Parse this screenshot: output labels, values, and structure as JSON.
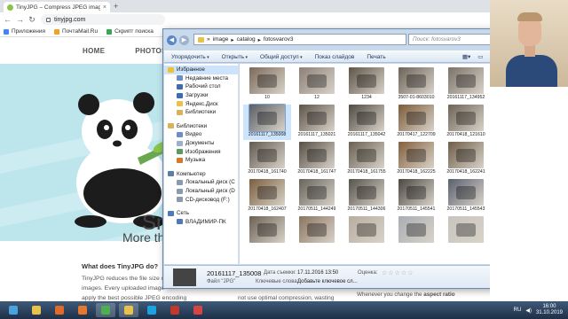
{
  "browser": {
    "tab_title": "TinyJPG – Compress JPEG images",
    "new_tab": "+",
    "url": "tinyjpg.com",
    "bookmarks": [
      "Приложения",
      "ПочтаMail.Ru",
      "Скрипт поиска"
    ]
  },
  "site": {
    "nav": [
      "HOME",
      "PHOTOSHOP"
    ],
    "hero_heading": "Sm",
    "hero_sub": "More tha",
    "section_title": "What does TinyJPG do?",
    "para_lines": [
      "TinyJPG reduces the file size o",
      "images. Every uploaded image",
      "apply the best possible JPEG encoding"
    ],
    "bottom_snippet": "not use optimal compression, wasting",
    "right_line1": "Whenever you change the",
    "right_line1_bold": "aspect ratio"
  },
  "explorer": {
    "path": [
      "image",
      "catalog",
      "fotosvarov3"
    ],
    "search_placeholder": "Поиск: fotosvarov3",
    "toolbar": [
      "Упорядочить",
      "Открыть",
      "Общий доступ",
      "Показ слайдов",
      "Печать"
    ],
    "nav": [
      {
        "label": "Избранное",
        "level": 0,
        "icon": "star-icon",
        "color": "#f0c030"
      },
      {
        "label": "Недавние места",
        "level": 1,
        "icon": "recent-places-icon",
        "color": "#6a8fc7"
      },
      {
        "label": "Рабочий стол",
        "level": 1,
        "icon": "desktop-icon",
        "color": "#3b6db4"
      },
      {
        "label": "Загрузки",
        "level": 1,
        "icon": "downloads-icon",
        "color": "#3b6db4"
      },
      {
        "label": "Яндекс.Диск",
        "level": 1,
        "icon": "yandex-disk-icon",
        "color": "#e8c24a"
      },
      {
        "label": "Библиотеки",
        "level": 1,
        "icon": "libraries-icon",
        "color": "#d9b25a"
      },
      {
        "label": "Библиотеки",
        "level": 0,
        "icon": "libraries-icon",
        "color": "#d9b25a",
        "gap": true
      },
      {
        "label": "Видео",
        "level": 1,
        "icon": "video-icon",
        "color": "#6a8fc7"
      },
      {
        "label": "Документы",
        "level": 1,
        "icon": "documents-icon",
        "color": "#9ab0cc"
      },
      {
        "label": "Изображения",
        "level": 1,
        "icon": "images-icon",
        "color": "#5a9a5a"
      },
      {
        "label": "Музыка",
        "level": 1,
        "icon": "music-icon",
        "color": "#d07b2f"
      },
      {
        "label": "Компьютер",
        "level": 0,
        "icon": "computer-icon",
        "color": "#5b7fa8",
        "gap": true
      },
      {
        "label": "Локальный диск (C",
        "level": 1,
        "icon": "drive-icon",
        "color": "#8a9bb0"
      },
      {
        "label": "Локальный диск (D",
        "level": 1,
        "icon": "drive-icon",
        "color": "#8a9bb0"
      },
      {
        "label": "CD-дисковод (F:)",
        "level": 1,
        "icon": "cd-drive-icon",
        "color": "#8a9bb0"
      },
      {
        "label": "Сеть",
        "level": 0,
        "icon": "network-icon",
        "color": "#4d7ab8",
        "gap": true
      },
      {
        "label": "ВЛАДИМИР-ПК",
        "level": 1,
        "icon": "pc-icon",
        "color": "#4d7ab8"
      }
    ],
    "files": [
      {
        "name": "10",
        "color": "#7a6a5a"
      },
      {
        "name": "12",
        "color": "#8c8078"
      },
      {
        "name": "1234",
        "color": "#5e5448"
      },
      {
        "name": "3507-01-8603010",
        "color": "#6b6358"
      },
      {
        "name": "20161117_134952",
        "color": "#7a7268"
      },
      {
        "name": "20161117_135008",
        "color": "#5a5e66",
        "selected": true
      },
      {
        "name": "20161117_135021",
        "color": "#5d5449"
      },
      {
        "name": "20161117_135042",
        "color": "#4f4a42"
      },
      {
        "name": "20170417_122709",
        "color": "#7c5b3a"
      },
      {
        "name": "20170418_121610",
        "color": "#6d6355"
      },
      {
        "name": "20170418_161740",
        "color": "#615a50"
      },
      {
        "name": "20170418_161747",
        "color": "#574f45"
      },
      {
        "name": "20170418_161755",
        "color": "#6a6052"
      },
      {
        "name": "20170418_162225",
        "color": "#83603d"
      },
      {
        "name": "20170418_162241",
        "color": "#6f5d48"
      },
      {
        "name": "20170418_162407",
        "color": "#7a5e3e"
      },
      {
        "name": "20170511_144249",
        "color": "#66635c"
      },
      {
        "name": "20170511_144306",
        "color": "#56534c"
      },
      {
        "name": "20170511_145541",
        "color": "#4a4640"
      },
      {
        "name": "20170511_145543",
        "color": "#5a6070"
      },
      {
        "name": "",
        "color": "#6c6054"
      },
      {
        "name": "",
        "color": "#8a7460"
      },
      {
        "name": "",
        "color": "#b8aca0"
      },
      {
        "name": "",
        "color": "#a9adb3"
      },
      {
        "name": "",
        "color": "#c8c4be"
      }
    ],
    "details": {
      "name": "20161117_135008",
      "type": "Файл \"JPG\"",
      "date_label": "Дата съемки:",
      "date_value": "17.11.2016 13:50",
      "keywords_label": "Ключевые слова:",
      "keywords_value": "Добавьте ключевое сл...",
      "rating_label": "Оценка:",
      "rating": 0,
      "rating_max": 5
    }
  },
  "taskbar": {
    "apps": [
      {
        "icon": "start-icon",
        "color": "#4aa3df"
      },
      {
        "icon": "explorer-icon",
        "color": "#e8c24a"
      },
      {
        "icon": "media-player-icon",
        "color": "#e06a2a"
      },
      {
        "icon": "firefox-icon",
        "color": "#e8772e"
      },
      {
        "icon": "chrome-icon",
        "color": "#4caf50",
        "active": true
      },
      {
        "icon": "folder-icon",
        "color": "#e8c24a",
        "active": true
      },
      {
        "icon": "skype-icon",
        "color": "#1aa3e0"
      },
      {
        "icon": "app-icon",
        "color": "#c0392b"
      },
      {
        "icon": "ccleaner-icon",
        "color": "#d64541"
      }
    ],
    "lang": "RU",
    "time": "16:00",
    "date": "31.10.2019"
  }
}
